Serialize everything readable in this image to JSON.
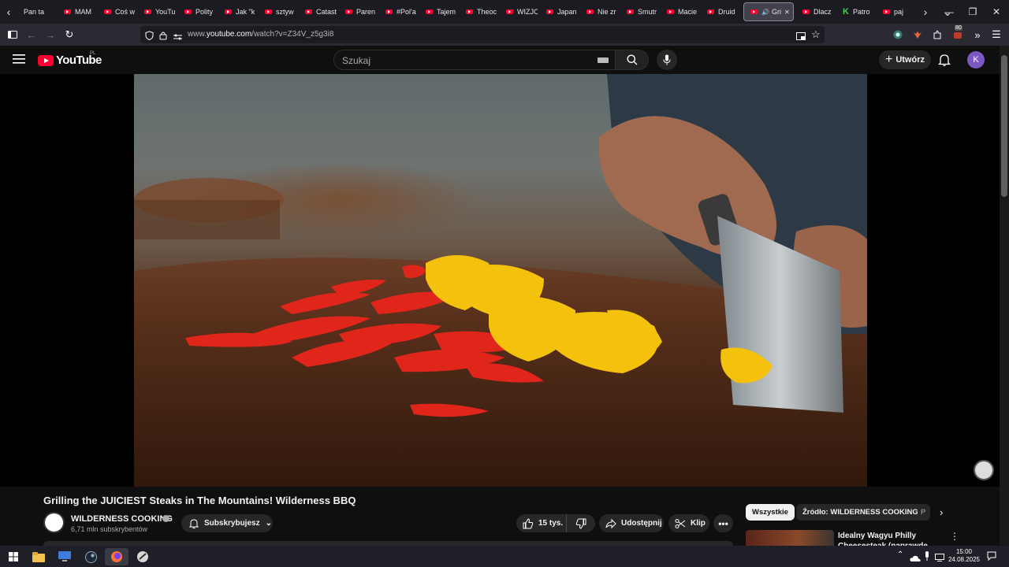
{
  "browser": {
    "tabs": [
      {
        "label": "Pan ta",
        "favicon": "firefox-tab-icon"
      },
      {
        "label": "MAM",
        "favicon": "youtube-icon"
      },
      {
        "label": "Coś w",
        "favicon": "youtube-icon"
      },
      {
        "label": "YouTu",
        "favicon": "youtube-icon"
      },
      {
        "label": "Polity",
        "favicon": "youtube-icon"
      },
      {
        "label": "Jak \"k",
        "favicon": "youtube-icon"
      },
      {
        "label": "sztyw",
        "favicon": "youtube-icon"
      },
      {
        "label": "Catast",
        "favicon": "youtube-icon"
      },
      {
        "label": "Paren",
        "favicon": "youtube-icon"
      },
      {
        "label": "#Pol'a",
        "favicon": "youtube-icon"
      },
      {
        "label": "Tajem",
        "favicon": "youtube-icon"
      },
      {
        "label": "Theoc",
        "favicon": "youtube-icon"
      },
      {
        "label": "WIZJC",
        "favicon": "youtube-icon"
      },
      {
        "label": "Japan",
        "favicon": "youtube-icon"
      },
      {
        "label": "Nie zr",
        "favicon": "youtube-icon"
      },
      {
        "label": "Smutr",
        "favicon": "youtube-icon"
      },
      {
        "label": "Macie",
        "favicon": "youtube-icon"
      },
      {
        "label": "Druid",
        "favicon": "youtube-icon"
      },
      {
        "label": "Gril",
        "favicon": "youtube-icon",
        "active": true
      },
      {
        "label": "Dlacz",
        "favicon": "youtube-icon"
      },
      {
        "label": "Patro",
        "favicon": "k-icon"
      },
      {
        "label": "paj",
        "favicon": "youtube-icon"
      }
    ],
    "url_prefix": "www.",
    "url_domain": "youtube.com",
    "url_path": "/watch?v=Z34V_z5g3i8",
    "extension_badge": "80"
  },
  "youtube": {
    "logo_text": "YouTube",
    "country_code": "PL",
    "search_placeholder": "Szukaj",
    "create_label": "Utwórz",
    "avatar_letter": "K",
    "video_title": "Grilling the JUICIEST Steaks in The Mountains! Wilderness BBQ",
    "channel_name": "WILDERNESS COOKING",
    "subscribers": "6,71 mln subskrybentów",
    "subscribe_label": "Subskrybujesz",
    "likes": "15 tys.",
    "share_label": "Udostępnij",
    "clip_label": "Klip",
    "chips": [
      "Wszystkie",
      "Źródło: WILDERNESS COOKING",
      "P"
    ],
    "recommended": [
      {
        "title": "Idealny Wagyu Philly Cheesesteak (naprawdę drogi)"
      }
    ]
  },
  "taskbar": {
    "time": "15:00",
    "date": "24.08.2025"
  },
  "colors": {
    "youtube_red": "#ff0033",
    "avatar_purple": "#7e57c2",
    "page_bg": "#0f0f0f"
  }
}
